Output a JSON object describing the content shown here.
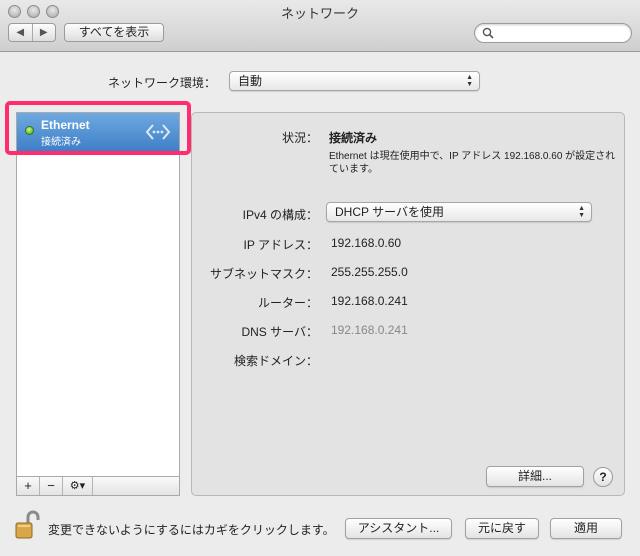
{
  "window": {
    "title": "ネットワーク"
  },
  "toolbar": {
    "back": "◀",
    "forward": "▶",
    "show_all": "すべてを表示",
    "search_placeholder": ""
  },
  "location": {
    "label": "ネットワーク環境：",
    "value": "自動"
  },
  "services": [
    {
      "name": "Ethernet",
      "status": "接続済み",
      "status_color": "#43a613"
    }
  ],
  "sidebar_controls": {
    "add": "+",
    "remove": "−",
    "action": "⚙▾"
  },
  "details": {
    "status_label": "状況：",
    "status_value": "接続済み",
    "status_description": "Ethernet は現在使用中で、IP アドレス 192.168.0.60 が設定されています。",
    "ipv4_label": "IPv4 の構成：",
    "ipv4_value": "DHCP サーバを使用",
    "ip_label": "IP アドレス：",
    "ip_value": "192.168.0.60",
    "subnet_label": "サブネットマスク：",
    "subnet_value": "255.255.255.0",
    "router_label": "ルーター：",
    "router_value": "192.168.0.241",
    "dns_label": "DNS サーバ：",
    "dns_value": "192.168.0.241",
    "search_domains_label": "検索ドメイン：",
    "advanced_button": "詳細...",
    "help_button": "?"
  },
  "footer": {
    "lock_text": "変更できないようにするにはカギをクリックします。",
    "assistant_button": "アシスタント...",
    "revert_button": "元に戻す",
    "apply_button": "適用"
  },
  "colors": {
    "selection": "#3f7fc8",
    "highlight_box": "#ff2d6e"
  }
}
